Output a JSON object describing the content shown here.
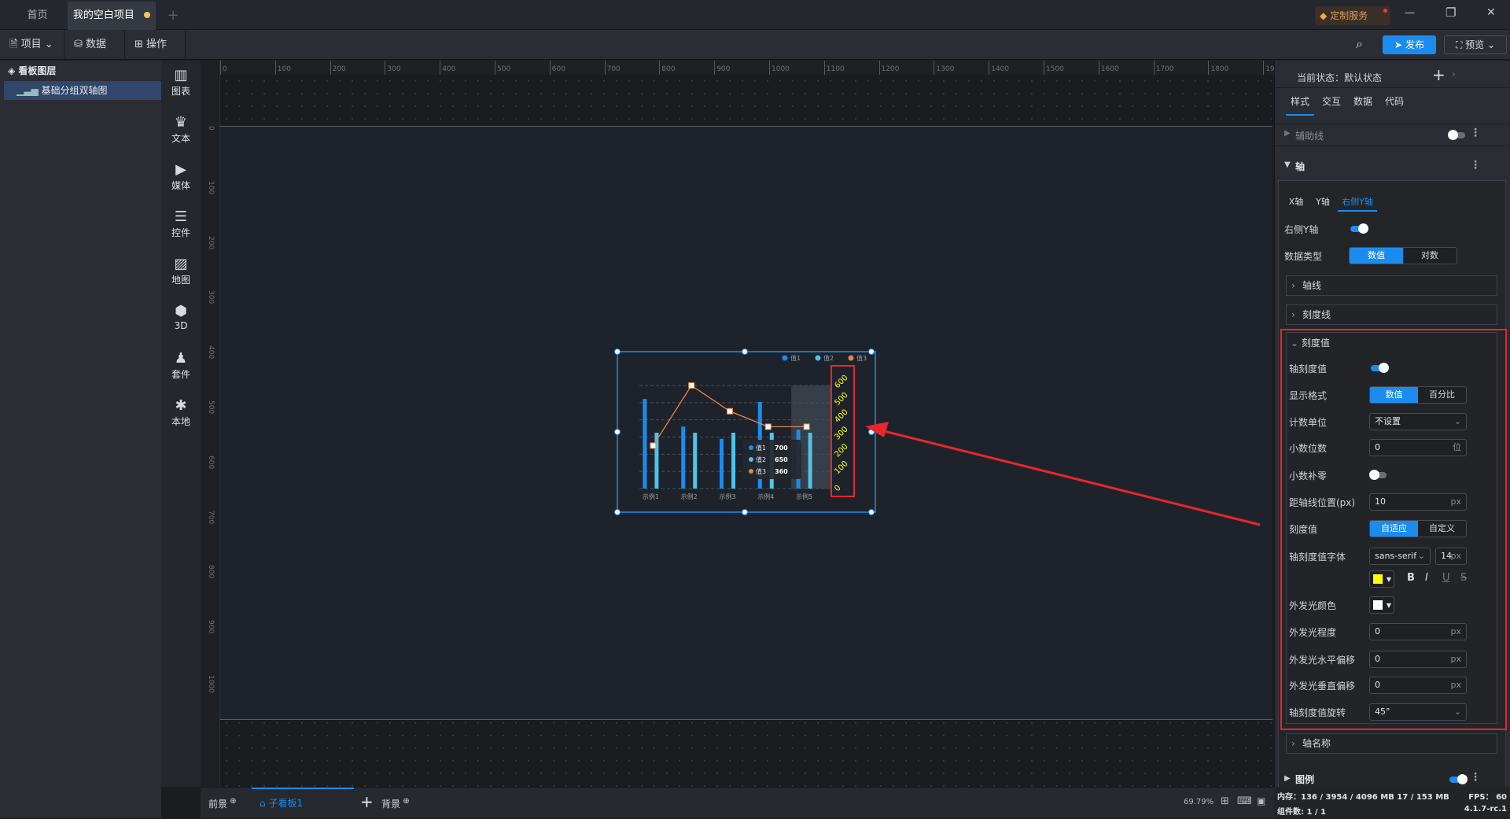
{
  "tabs": {
    "home": "首页",
    "project": "我的空白项目",
    "add": "+"
  },
  "title_bar": {
    "service": "定制服务",
    "minimize": "—",
    "restore": "❐",
    "close": "✕"
  },
  "toolbar": {
    "project": "项目",
    "data": "数据",
    "operate": "操作",
    "publish": "发布",
    "preview": "预览"
  },
  "layers": {
    "title": "看板图层",
    "items": [
      {
        "label": "基础分组双轴图"
      }
    ]
  },
  "tools": [
    {
      "label": "图表",
      "icon": "chart-icon"
    },
    {
      "label": "文本",
      "icon": "text-icon"
    },
    {
      "label": "媒体",
      "icon": "media-icon"
    },
    {
      "label": "控件",
      "icon": "widget-icon"
    },
    {
      "label": "地图",
      "icon": "map-icon"
    },
    {
      "label": "3D",
      "icon": "cube-icon"
    },
    {
      "label": "套件",
      "icon": "suite-icon"
    },
    {
      "label": "本地",
      "icon": "puzzle-icon"
    }
  ],
  "ruler": {
    "h": [
      "0",
      "100",
      "200",
      "300",
      "400",
      "500",
      "600",
      "700",
      "800",
      "900",
      "1000",
      "1100",
      "1200",
      "1300",
      "1400",
      "1500",
      "1600",
      "1700",
      "1800",
      "1900"
    ],
    "v": [
      "0",
      "100",
      "200",
      "300",
      "400",
      "500",
      "600",
      "700",
      "800",
      "900",
      "1000"
    ]
  },
  "bottom": {
    "foreground": "前景",
    "subboard": "子看板1",
    "add": "+",
    "background": "背景",
    "zoom": "69.79%"
  },
  "panel": {
    "state_label": "当前状态：默认状态",
    "tabs": [
      "样式",
      "交互",
      "数据",
      "代码"
    ],
    "guides": "辅助线",
    "axis": "轴",
    "axis_tabs": [
      "X轴",
      "Y轴",
      "右侧Y轴"
    ],
    "right_y": "右侧Y轴",
    "data_type": {
      "label": "数据类型",
      "options": [
        "数值",
        "对数"
      ],
      "selected": "数值"
    },
    "axis_line": "轴线",
    "tick_line": "刻度线",
    "tick_value": "刻度值",
    "fields": {
      "show": "轴刻度值",
      "format": {
        "label": "显示格式",
        "options": [
          "数值",
          "百分比"
        ]
      },
      "unit": {
        "label": "计数单位",
        "value": "不设置"
      },
      "decimals": {
        "label": "小数位数",
        "value": "0",
        "unit": "位"
      },
      "pad_zero": "小数补零",
      "offset": {
        "label": "距轴线位置(px)",
        "value": "10",
        "unit": "px"
      },
      "mode": {
        "label": "刻度值",
        "options": [
          "自适应",
          "自定义"
        ]
      },
      "font": {
        "label": "轴刻度值字体",
        "family": "sans-serif",
        "size": "14",
        "unit": "px",
        "color": "#ffff00",
        "bold": "B",
        "italic": "I",
        "underline": "U",
        "strike": "S"
      },
      "glow_color": {
        "label": "外发光颜色",
        "color": "#ffffff"
      },
      "glow": {
        "label": "外发光程度",
        "value": "0",
        "unit": "px"
      },
      "glow_x": {
        "label": "外发光水平偏移",
        "value": "0",
        "unit": "px"
      },
      "glow_y": {
        "label": "外发光垂直偏移",
        "value": "0",
        "unit": "px"
      },
      "rotate": {
        "label": "轴刻度值旋转",
        "value": "45°"
      }
    },
    "axis_name": "轴名称",
    "legend": "图例"
  },
  "status": {
    "memory": "内存：136 / 3954 / 4096 MB  17 / 153 MB",
    "fps": "FPS：  60",
    "count": "组件数: 1 / 1",
    "version": "4.1.7-rc.1"
  },
  "chart_data": {
    "type": "bar+line",
    "categories": [
      "示例1",
      "示例2",
      "示例3",
      "示例4",
      "示例5"
    ],
    "series": [
      {
        "name": "值1",
        "type": "bar",
        "color": "#1a8cf0",
        "values": [
          705,
          660,
          640,
          700,
          655
        ]
      },
      {
        "name": "值2",
        "type": "bar",
        "color": "#4cc4ea",
        "values": [
          650,
          650,
          650,
          650,
          650
        ]
      },
      {
        "name": "值3",
        "type": "line",
        "color": "#e8834a",
        "values": [
          250,
          600,
          450,
          360,
          360
        ]
      }
    ],
    "right_axis": {
      "ticks": [
        "0",
        "100",
        "200",
        "300",
        "400",
        "500",
        "600"
      ],
      "range": [
        0,
        600
      ],
      "label_color": "#ffff00",
      "rotate": 45
    },
    "tooltip": {
      "category": "示例4",
      "rows": [
        {
          "name": "值1",
          "value": "700"
        },
        {
          "name": "值2",
          "value": "650"
        },
        {
          "name": "值3",
          "value": "360"
        }
      ]
    },
    "grid": true,
    "legend": "top-right"
  }
}
